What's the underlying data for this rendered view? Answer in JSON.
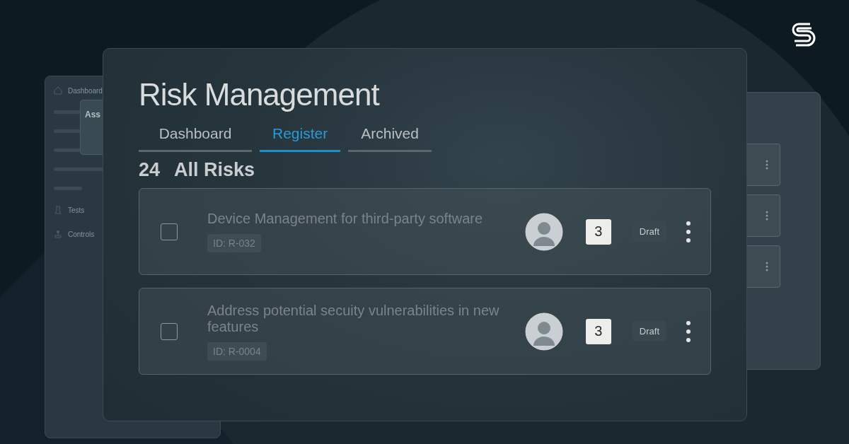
{
  "back_panel": {
    "nav": [
      {
        "label": "Dashboard"
      },
      {
        "label": "Tests"
      },
      {
        "label": "Controls"
      }
    ],
    "dialog_title": "Ass"
  },
  "main": {
    "title": "Risk Management",
    "tabs": [
      {
        "label": "Dashboard",
        "selected": false
      },
      {
        "label": "Register",
        "selected": true
      },
      {
        "label": "Archived",
        "selected": false
      }
    ],
    "count": "24",
    "list_title": "All Risks",
    "rows": [
      {
        "checked": false,
        "title": "Device Management for third-party software",
        "id": "ID: R-032",
        "score": "3",
        "status": "Draft"
      },
      {
        "checked": false,
        "title": "Address potential secuity vulnerabilities in new features",
        "id": "ID: R-0004",
        "score": "3",
        "status": "Draft"
      }
    ]
  }
}
